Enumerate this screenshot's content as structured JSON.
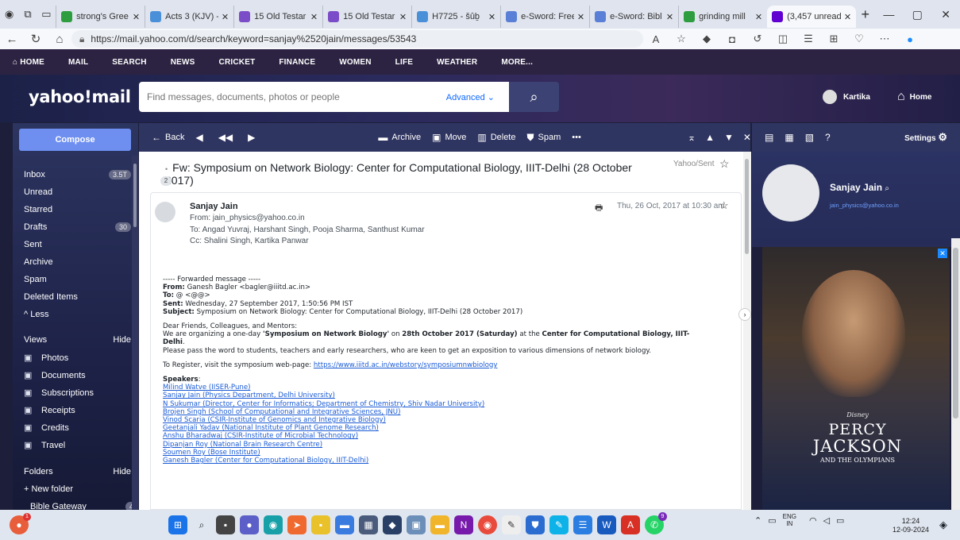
{
  "browser": {
    "tabs": [
      {
        "title": "strong's Gree",
        "color": "#2d9d3f"
      },
      {
        "title": "Acts 3 (KJV) -",
        "color": "#4a90d9"
      },
      {
        "title": "15 Old Testar",
        "color": "#7b4cc8"
      },
      {
        "title": "15 Old Testar",
        "color": "#7b4cc8"
      },
      {
        "title": "H7725 - šûḇ",
        "color": "#4a90d9"
      },
      {
        "title": "e-Sword: Free",
        "color": "#5a7fd6"
      },
      {
        "title": "e-Sword: Bibl",
        "color": "#5a7fd6"
      },
      {
        "title": "grinding mill",
        "color": "#2d9d3f"
      },
      {
        "title": "(3,457 unread",
        "color": "#6001d2"
      }
    ],
    "url": "https://mail.yahoo.com/d/search/keyword=sanjay%2520jain/messages/53543"
  },
  "yahoo_nav": [
    "HOME",
    "MAIL",
    "SEARCH",
    "NEWS",
    "CRICKET",
    "FINANCE",
    "WOMEN",
    "LIFE",
    "WEATHER",
    "MORE..."
  ],
  "header": {
    "logo": "yahoo!mail",
    "search_placeholder": "Find messages, documents, photos or people",
    "advanced": "Advanced",
    "user": "Kartika",
    "home": "Home"
  },
  "sidebar": {
    "compose": "Compose",
    "folders": [
      {
        "label": "Inbox",
        "count": "3.5T"
      },
      {
        "label": "Unread",
        "count": ""
      },
      {
        "label": "Starred",
        "count": ""
      },
      {
        "label": "Drafts",
        "count": "30"
      },
      {
        "label": "Sent",
        "count": ""
      },
      {
        "label": "Archive",
        "count": ""
      },
      {
        "label": "Spam",
        "count": ""
      },
      {
        "label": "Deleted Items",
        "count": ""
      },
      {
        "label": "^ Less",
        "count": ""
      }
    ],
    "views_title": "Views",
    "hide": "Hide",
    "views": [
      {
        "label": "Photos",
        "icon": "photo-icon"
      },
      {
        "label": "Documents",
        "icon": "document-icon"
      },
      {
        "label": "Subscriptions",
        "icon": "subscriptions-icon"
      },
      {
        "label": "Receipts",
        "icon": "receipt-icon"
      },
      {
        "label": "Credits",
        "icon": "credit-card-icon"
      },
      {
        "label": "Travel",
        "icon": "plane-icon"
      }
    ],
    "folders_title": "Folders",
    "new_folder": "+ New folder",
    "custom_folders": [
      {
        "label": "Bible Gateway",
        "count": "4"
      }
    ]
  },
  "toolbar": {
    "back": "Back",
    "archive": "Archive",
    "move": "Move",
    "delete": "Delete",
    "spam": "Spam",
    "more": "•••"
  },
  "message": {
    "subject": "Fw: Symposium on Network Biology: Center for Computational Biology, IIIT-Delhi (28 October 2017)",
    "folder_tag": "Yahoo/Sent",
    "thread_count": "2",
    "sender": "Sanjay Jain",
    "from_label": "From:",
    "from": "jain_physics@yahoo.co.in",
    "to_label": "To:",
    "to": "Angad Yuvraj,  Harshant Singh,  Pooja Sharma,  Santhust Kumar",
    "cc_label": "Cc:",
    "cc": "Shalini Singh,  Kartika Panwar",
    "date": "Thu, 26 Oct, 2017 at 10:30 am",
    "body": {
      "fwd_line": "----- Forwarded message -----",
      "from_k": "From:",
      "from_v": " Ganesh Bagler <bagler@iiitd.ac.in>",
      "to_k": "To:",
      "to_v": " @ <@@>",
      "sent_k": "Sent:",
      "sent_v": " Wednesday, 27 September 2017, 1:50:56 PM IST",
      "subj_k": "Subject:",
      "subj_v": " Symposium on Network Biology: Center for Computational Biology, IIIT-Delhi (28 October 2017)",
      "greeting": "Dear Friends, Colleagues, and Mentors:",
      "p1_a": "We are organizing a one-day ",
      "p1_b": "'Symposium on Network Biology'",
      "p1_c": " on ",
      "p1_d": "28th October 2017 (Saturday)",
      "p1_e": " at the ",
      "p1_f": "Center for Computational Biology, IIIT-Delhi",
      "p1_g": ".",
      "p2": "Please pass the word to students, teachers and early researchers, who are keen to get an exposition to various dimensions of network biology.",
      "reg_a": "To Register, visit the symposium web-page: ",
      "reg_link": "https://www.iiitd.ac.in/webstory/symposiumnwbiology",
      "speakers_title": "Speakers",
      "speakers": [
        "Milind Watve (IISER-Pune)",
        "Sanjay Jain (Physics Department, Delhi University)",
        "N Sukumar (Director, Center for Informatics; Department of Chemistry, Shiv Nadar University)",
        "Brojen Singh (School of Computational and Integrative Sciences, JNU)",
        "Vinod Scaria (CSIR-Institute of Genomics and Integrative Biology)",
        "Geetanjali Yadav (National Institute of Plant Genome Research)",
        "Anshu Bharadwaj (CSIR-Institute of Microbial Technology)",
        "Dipanjan Roy (National Brain Research Centre)",
        "Soumen Roy (Bose Institute)",
        "Ganesh Bagler (Center for Computational Biology, IIIT-Delhi)"
      ]
    }
  },
  "right_panel": {
    "settings": "Settings",
    "contact_name": "Sanjay Jain",
    "contact_email": "jain_physics@yahoo.co.in",
    "ad_brand": "Disney",
    "ad_line1": "PERCY",
    "ad_line2": "JACKSON",
    "ad_line3": "AND THE OLYMPIANS"
  },
  "taskbar": {
    "lang1": "ENG",
    "lang2": "IN",
    "time": "12:24",
    "date": "12-09-2024",
    "badge": "9"
  }
}
